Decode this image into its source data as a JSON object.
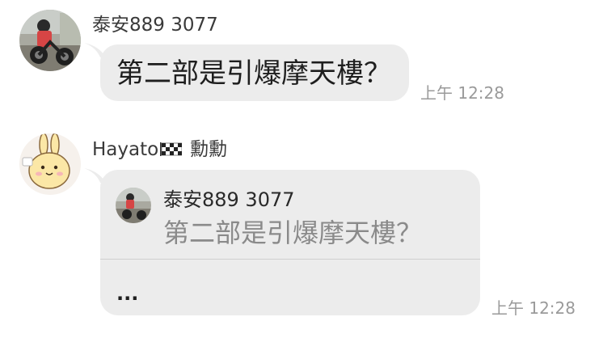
{
  "messages": [
    {
      "sender": "泰安889 3077",
      "text": "第二部是引爆摩天樓？",
      "time": "上午 12:28"
    },
    {
      "sender_name": "Hayato",
      "sender_flag_icon": "checkered-flag-icon",
      "sender_suffix": "勳勳",
      "quote": {
        "sender": "泰安889 3077",
        "text": "第二部是引爆摩天樓？"
      },
      "text": "...",
      "time": "上午 12:28"
    }
  ],
  "colors": {
    "bubble": "#ececec",
    "timestamp": "#9a9a9a",
    "quote_text": "#8a8a8a"
  }
}
